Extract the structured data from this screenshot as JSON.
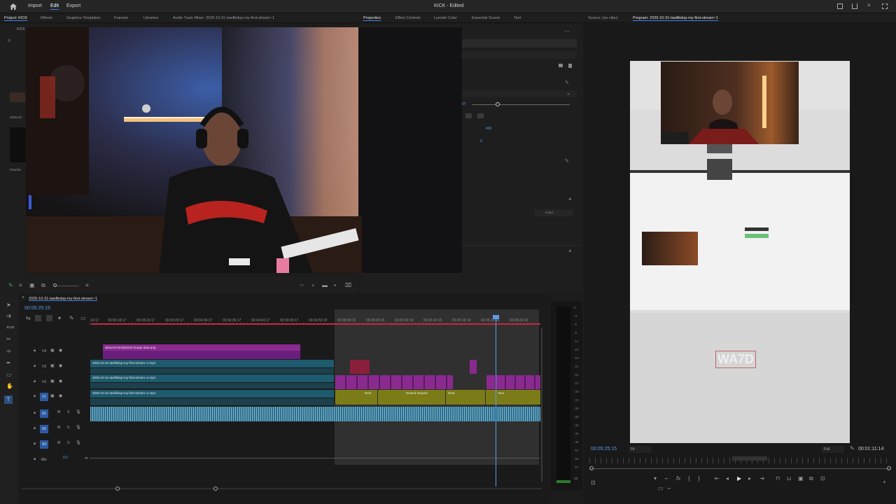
{
  "app": {
    "title": "KICK - Edited"
  },
  "menu": {
    "import": "Import",
    "edit": "Edit",
    "export": "Export"
  },
  "left_tabs": [
    "Project: KICK",
    "Effects",
    "Graphics Templates",
    "Frameio",
    "Libraries",
    "Audio Track Mixer: 2025-10-31-tawfikdop-my-first-stream~1"
  ],
  "project_panel": {
    "crumb": "KICK",
    "bin_label": "2025-10-",
    "footer_label": "Final kic"
  },
  "mid_tabs": [
    "Properties",
    "Effect Controls",
    "Lumetri Color",
    "Essential Sound",
    "Text"
  ],
  "properties": {
    "value_a": "400",
    "value_b": "0",
    "value_c": "07",
    "dropdown": "Outer"
  },
  "right_tabs": [
    "Source: (no clips)",
    "Program: 2025-10-31-tawfikdop-my-first-stream~1"
  ],
  "program": {
    "timecode": "00:05:25:15",
    "fit": "Fit",
    "quality": "Full",
    "duration": "00:01:11:14",
    "watermark": "WA7D"
  },
  "timeline": {
    "sequence_name": "2025-10-31-tawfikdop-my-first-stream~1",
    "timecode": "00:05:25:15",
    "ruler": [
      "14:17",
      "00:04:19:17",
      "00:04:24:17",
      "00:04:29:17",
      "00:04:34:17",
      "00:04:39:17",
      "00:04:44:17",
      "00:04:49:17",
      "00:04:54:16",
      "00:04:59:16",
      "00:05:04:16",
      "00:05:09:16",
      "00:05:14:16",
      "00:05:19:16",
      "00:05:24:16",
      "00:05:29:16"
    ],
    "video_tracks": [
      "V4",
      "V3",
      "V2",
      "V1"
    ],
    "audio_tracks": [
      "A1",
      "A2",
      "A3"
    ],
    "mix_label": "Mix",
    "mix_value": "0.0",
    "clips": {
      "v4": "alexa-8-introduction-image-data.png",
      "v3": "2025-10-31-tawfikdop-my-first-stream~1.mp4",
      "v2": "2025-10-31-tawfikdop-my-first-stream~1.mp4",
      "v1": "2025-10-31-tawfikdop-my-first-stream~1.mp4",
      "g1": "Nest",
      "g2": "Nested Sequen",
      "g3": "Nest",
      "g4": "Nes"
    }
  },
  "meter": {
    "labels": [
      "0",
      "-3",
      "-6",
      "-9",
      "-12",
      "-15",
      "-18",
      "-21",
      "-24",
      "-27",
      "-30",
      "-33",
      "-36",
      "-39",
      "-42",
      "-45",
      "-48",
      "-51",
      "-54",
      "-57",
      "dB"
    ]
  },
  "colors": {
    "accent": "#3d7be8",
    "teal_clip": "#1f5b6e",
    "purple_clip": "#6a1f7d",
    "magenta_clip": "#8a2a8f",
    "olive_clip": "#7b7c17",
    "red_clip": "#8a1f3b",
    "playhead": "#5a9be8"
  }
}
